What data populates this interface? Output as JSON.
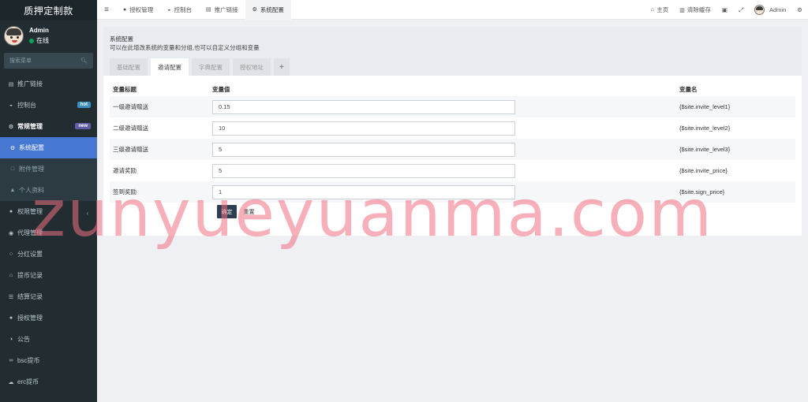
{
  "app": {
    "title": "质押定制款"
  },
  "user": {
    "name": "Admin",
    "status": "在线"
  },
  "search": {
    "placeholder": "搜索菜单"
  },
  "sidebar": {
    "items": [
      {
        "label": "推广链接",
        "icon": "link-icon"
      },
      {
        "label": "控制台",
        "icon": "dashboard-icon",
        "badge": "hot"
      },
      {
        "label": "常规管理",
        "icon": "cogs-icon",
        "badge": "new"
      },
      {
        "label": "系统配置",
        "icon": "gear-icon"
      },
      {
        "label": "附件管理",
        "icon": "file-icon"
      },
      {
        "label": "个人资料",
        "icon": "user-icon"
      },
      {
        "label": "权限管理",
        "icon": "group-icon"
      },
      {
        "label": "代理管理",
        "icon": "user-circle-icon"
      },
      {
        "label": "分红设置",
        "icon": "circle-icon"
      },
      {
        "label": "提币记录",
        "icon": "bank-icon"
      },
      {
        "label": "结算记录",
        "icon": "list-icon"
      },
      {
        "label": "授权管理",
        "icon": "group-icon"
      },
      {
        "label": "公告",
        "icon": "half-circle-icon"
      },
      {
        "label": "bsc提币",
        "icon": "bicycle-icon"
      },
      {
        "label": "erc提币",
        "icon": "cloud-icon"
      }
    ]
  },
  "topnav": {
    "tabs": [
      {
        "label": "授权管理",
        "icon": "group-icon"
      },
      {
        "label": "控制台",
        "icon": "dashboard-icon"
      },
      {
        "label": "推广链接",
        "icon": "link-icon"
      },
      {
        "label": "系统配置",
        "icon": "gear-icon"
      }
    ],
    "right": [
      {
        "label": "主页",
        "icon": "home-icon"
      },
      {
        "label": "清除缓存",
        "icon": "trash-icon"
      }
    ],
    "user": "Admin"
  },
  "panel": {
    "title": "系统配置",
    "desc": "可以在此增改系统的变量和分组,也可以自定义分组和变量",
    "tabs": [
      "基础配置",
      "邀请配置",
      "字典配置",
      "授权地址",
      "+"
    ]
  },
  "table": {
    "headers": [
      "变量标题",
      "变量值",
      "变量名"
    ],
    "rows": [
      {
        "title": "一级邀请赠送",
        "value": "0.15",
        "name": "{$site.invite_level1}"
      },
      {
        "title": "二级邀请赠送",
        "value": "10",
        "name": "{$site.invite_level2}"
      },
      {
        "title": "三级邀请赠送",
        "value": "5",
        "name": "{$site.invite_level3}"
      },
      {
        "title": "邀请奖励",
        "value": "5",
        "name": "{$site.invite_price}"
      },
      {
        "title": "签到奖励",
        "value": "1",
        "name": "{$site.sign_price}"
      }
    ]
  },
  "buttons": {
    "ok": "确定",
    "reset": "重置"
  },
  "watermark": "zunyueyuanma.com",
  "colors": {
    "sidebar_bg": "#222d32",
    "active_item": "#4778d1",
    "ok_button": "#2c3e50",
    "watermark": "#f06e82"
  }
}
